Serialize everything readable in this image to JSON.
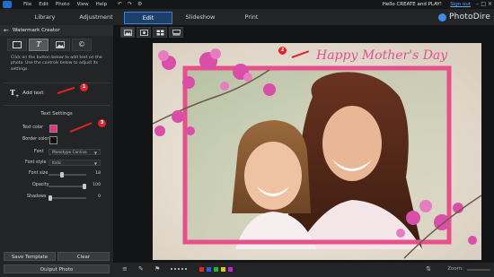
{
  "titlebar": {
    "menus": [
      "File",
      "Edit",
      "Photo",
      "View",
      "Help"
    ],
    "greeting": "Hello CREATE and PLAY!",
    "sign_out": "Sign out"
  },
  "nav": {
    "tabs": [
      "Library",
      "Adjustment",
      "Edit",
      "Slideshow",
      "Print"
    ],
    "active_tab": "Edit",
    "brand": "PhotoDire"
  },
  "panel": {
    "title": "Watermark Creator",
    "instructions": "Click on the button below to add text on the photo. Use the controls below to adjust its settings.",
    "add_text_label": "Add text",
    "text_settings_title": "Text Settings",
    "text_color_label": "Text color",
    "text_color_value": "#e0387f",
    "border_color_label": "Border color",
    "border_color_value": "#111111",
    "font_label": "Font",
    "font_value": "Monotype Corsiva",
    "font_style_label": "Font style",
    "font_style_value": "Italic",
    "font_size_label": "Font size",
    "font_size_value": "18",
    "opacity_label": "Opacity",
    "opacity_value": "100",
    "shadows_label": "Shadows",
    "shadows_value": "0",
    "save_template_label": "Save Template",
    "clear_label": "Clear",
    "output_photo_label": "Output Photo"
  },
  "sliders": {
    "font_size_fraction": 0.35,
    "opacity_fraction": 1.0,
    "shadows_fraction": 0.0
  },
  "annotations": [
    "1",
    "2",
    "3"
  ],
  "photo": {
    "watermark_text": "Happy Mother's Day",
    "frame_color": "#e8508c"
  },
  "bottombar": {
    "zoom_label": "Zoom:",
    "color_dots": [
      "#d62c2c",
      "#2f5fd3",
      "#2fae3c",
      "#d6c42a",
      "#b32fc4"
    ]
  },
  "colors": {
    "accent": "#3c7fd0",
    "annotation_red": "#e32229"
  }
}
